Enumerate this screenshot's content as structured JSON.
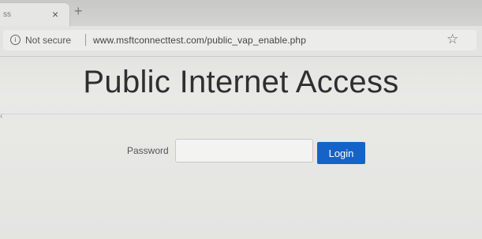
{
  "browser": {
    "tab_title": "ss",
    "tab_close_glyph": "×",
    "new_tab_glyph": "+",
    "info_icon_glyph": "i",
    "security_label": "Not secure",
    "url": "www.msftconnecttest.com/public_vap_enable.php",
    "bookmark_icon_glyph": "☆"
  },
  "page": {
    "title": "Public Internet Access",
    "password_label": "Password",
    "password_value": "",
    "password_placeholder": "",
    "login_label": "Login",
    "edge_mark": "‹"
  },
  "colors": {
    "login_button": "#1663c7",
    "title_text": "#2f2f30"
  }
}
